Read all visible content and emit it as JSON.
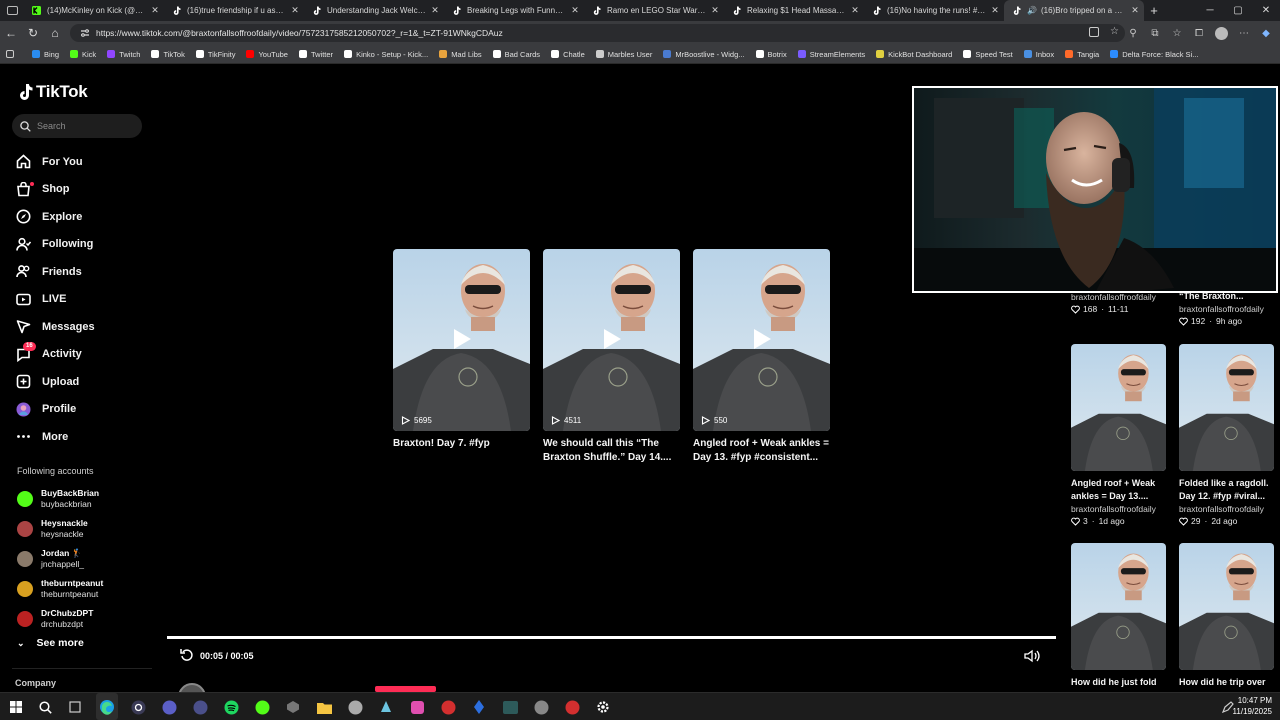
{
  "browser": {
    "tabs": [
      {
        "title": "(14)McKinley on Kick (@mckin",
        "icon": "kick-icon"
      },
      {
        "title": "(16)true friendship if u ask me",
        "icon": "tiktok-icon"
      },
      {
        "title": "Understanding Jack Welch's Le",
        "icon": "tiktok-icon"
      },
      {
        "title": "Breaking Legs with Funny Dan",
        "icon": "tiktok-icon"
      },
      {
        "title": "Ramo en LEGO Star Wars: ¿Qu",
        "icon": "tiktok-icon"
      },
      {
        "title": "Relaxing $1 Head Massage Ex",
        "icon": "tiktok-icon"
      },
      {
        "title": "(16)No having the runs! #heyn",
        "icon": "tiktok-icon"
      },
      {
        "title": "(16)Bro tripped on a conc",
        "icon": "tiktok-icon",
        "active": true
      }
    ],
    "close_glyph": "✕",
    "newtab_glyph": "+",
    "url": "https://www.tiktok.com/@braxtonfallsoffroofdaily/video/7572317585212050702?_r=1&_t=ZT-91WNkgCDAuz",
    "bookmarks": [
      {
        "label": "Bing",
        "color": "#2a8cf0"
      },
      {
        "label": "Kick",
        "color": "#53fc18"
      },
      {
        "label": "Twitch",
        "color": "#9146ff"
      },
      {
        "label": "TikTok",
        "color": "#ffffff"
      },
      {
        "label": "TikFinity",
        "color": "#ffffff"
      },
      {
        "label": "YouTube",
        "color": "#ff0000"
      },
      {
        "label": "Twitter",
        "color": "#ffffff"
      },
      {
        "label": "Kinko - Setup - Kick...",
        "color": "#ffffff"
      },
      {
        "label": "Mad Libs",
        "color": "#e8a33d"
      },
      {
        "label": "Bad Cards",
        "color": "#ffffff"
      },
      {
        "label": "Chatle",
        "color": "#ffffff"
      },
      {
        "label": "Marbles User",
        "color": "#cccccc"
      },
      {
        "label": "MrBoostlive - Widg...",
        "color": "#4a7bd0"
      },
      {
        "label": "Botrix",
        "color": "#ffffff"
      },
      {
        "label": "StreamElements",
        "color": "#7b5cff"
      },
      {
        "label": "KickBot Dashboard",
        "color": "#e0d040"
      },
      {
        "label": "Speed Test",
        "color": "#ffffff"
      },
      {
        "label": "Inbox",
        "color": "#4a90e2"
      },
      {
        "label": "Tangia",
        "color": "#ff6a2a"
      },
      {
        "label": "Delta Force: Black Si...",
        "color": "#2c8cff"
      }
    ]
  },
  "tiktok": {
    "logo": "TikTok",
    "search_placeholder": "Search",
    "nav": [
      {
        "label": "For You",
        "icon": "home-icon"
      },
      {
        "label": "Shop",
        "icon": "shop-icon"
      },
      {
        "label": "Explore",
        "icon": "compass-icon"
      },
      {
        "label": "Following",
        "icon": "following-icon"
      },
      {
        "label": "Friends",
        "icon": "friends-icon"
      },
      {
        "label": "LIVE",
        "icon": "live-icon"
      },
      {
        "label": "Messages",
        "icon": "messages-icon"
      },
      {
        "label": "Activity",
        "icon": "activity-icon",
        "badge": "16"
      },
      {
        "label": "Upload",
        "icon": "upload-icon"
      },
      {
        "label": "Profile",
        "icon": "profile-avatar-icon"
      },
      {
        "label": "More",
        "icon": "more-icon"
      }
    ],
    "following_title": "Following accounts",
    "following": [
      {
        "name": "BuyBackBrian",
        "handle": "buybackbrian",
        "color": "#53fc18"
      },
      {
        "name": "Heysnackle",
        "handle": "heysnackle",
        "color": "#a44"
      },
      {
        "name": "Jordan 🏌",
        "handle": "jnchappell_",
        "color": "#8a7a6a"
      },
      {
        "name": "theburntpeanut",
        "handle": "theburntpeanut",
        "color": "#d8a020"
      },
      {
        "name": "DrChubzDPT",
        "handle": "drchubzdpt",
        "color": "#b22"
      }
    ],
    "see_more": "See more",
    "company": "Company"
  },
  "grid": [
    {
      "views": "5695",
      "title": "Braxton! Day 7. #fyp"
    },
    {
      "views": "4511",
      "title": "We should call this “The\nBraxton Shuffle.” Day 14...."
    },
    {
      "views": "550",
      "title": "Angled roof + Weak ankles =\nDay 13. #fyp #consistent..."
    }
  ],
  "right": {
    "top_partial": [
      {
        "author": "braxtonfallsoffroofdaily",
        "likes": "168",
        "age": "11-11"
      },
      {
        "title": "“The Braxton...",
        "author": "braxtonfallsoffroofdaily",
        "likes": "192",
        "age": "9h ago"
      }
    ],
    "cards": [
      {
        "title": "Angled roof + Weak\nankles = Day 13....",
        "author": "braxtonfallsoffroofdaily",
        "likes": "3",
        "age": "1d ago"
      },
      {
        "title": "Folded like a ragdoll.\nDay 12. #fyp #viral...",
        "author": "braxtonfallsoffroofdaily",
        "likes": "29",
        "age": "2d ago"
      },
      {
        "title": "How did he just fold",
        "author": "",
        "likes": "",
        "age": ""
      },
      {
        "title": "How did he trip over",
        "author": "",
        "likes": "",
        "age": ""
      }
    ]
  },
  "player": {
    "time": "00:05 / 00:05",
    "progress": 1.0,
    "owner": "braxtonfallsoffroofdaily"
  },
  "taskbar": {
    "time": "10:47 PM",
    "date": "11/19/2025"
  },
  "colors": {
    "accent": "#fe2c55",
    "bg": "#000000"
  }
}
